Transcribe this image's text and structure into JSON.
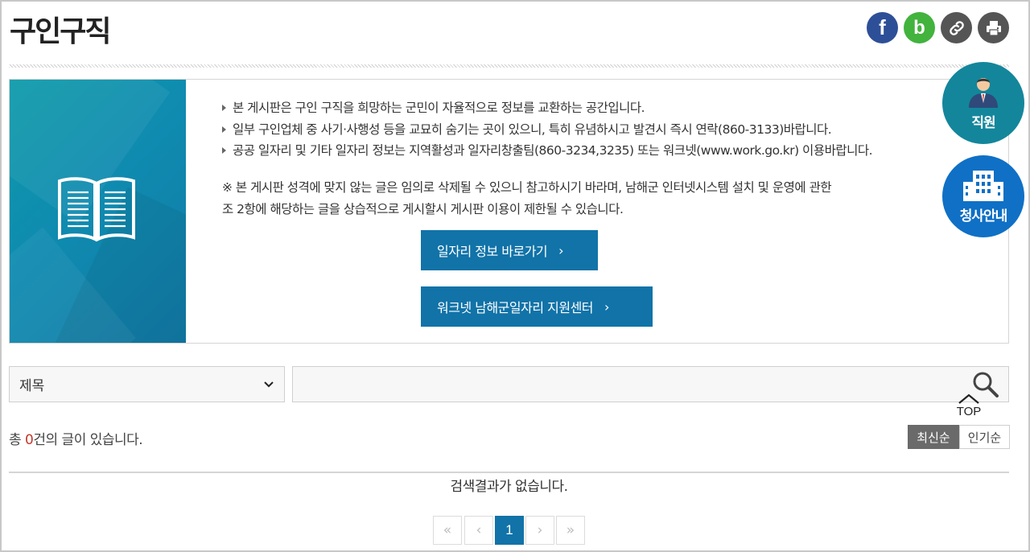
{
  "page": {
    "title": "구인구직"
  },
  "share": {
    "facebook_glyph": "f",
    "blog_glyph": "b",
    "link_icon": "link-icon",
    "print_icon": "print-icon",
    "colors": {
      "facebook": "#2d4f97",
      "blog": "#42b33d",
      "link": "#555555",
      "print": "#555555"
    }
  },
  "notice": {
    "items": [
      "본 게시판은 구인 구직을 희망하는 군민이 자율적으로 정보를 교환하는 공간입니다.",
      "일부 구인업체 중 사기·사행성 등을 교묘히 숨기는 곳이 있으니, 특히 유념하시고 발견시 즉시 연락(860-3133)바랍니다.",
      "공공 일자리 및 기타 일자리 정보는 지역활성과 일자리창출팀(860-3234,3235) 또는 워크넷(www.work.go.kr) 이용바랍니다."
    ],
    "extra_line1": "※ 본 게시판 성격에 맞지 않는 글은 임의로 삭제될 수 있으니 참고하시기 바라며, 남해군 인터넷시스템 설치 및 운영에 관한",
    "extra_line2": "조 2항에 해당하는 글을 상습적으로 게시할시 게시판 이용이 제한될 수 있습니다.",
    "button_jobs": "일자리 정보 바로가기",
    "button_worknet": "워크넷 남해군일자리 지원센터",
    "chevron": "›",
    "icon": "book-icon"
  },
  "floating": {
    "staff_label": "직원",
    "office_label": "청사안내",
    "top_label": "TOP"
  },
  "search": {
    "select_value": "제목",
    "select_arrow": "⌄",
    "input_value": "",
    "icon": "search-icon"
  },
  "list": {
    "count_prefix": "총 ",
    "count_value": "0",
    "count_suffix": "건의 글이 있습니다.",
    "sort_latest": "최신순",
    "sort_popular": "인기순",
    "empty_message": "검색결과가 없습니다."
  },
  "pagination": {
    "first": "«",
    "prev": "‹",
    "current": "1",
    "next": "›",
    "last": "»"
  },
  "colors": {
    "accent": "#1173a8",
    "staff": "#13869c",
    "office": "#0f70c6",
    "count_highlight": "#c0392b"
  }
}
